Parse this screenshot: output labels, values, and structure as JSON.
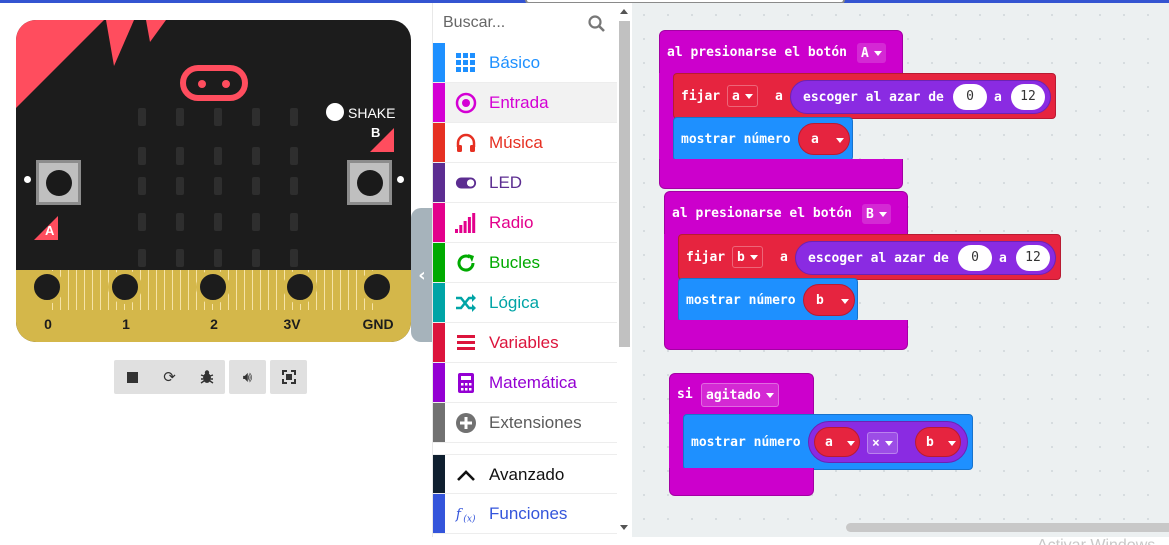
{
  "simulator": {
    "shake_label": "SHAKE",
    "button_a_label": "A",
    "button_b_label": "B",
    "pins": [
      "0",
      "1",
      "2",
      "3V",
      "GND"
    ],
    "controls": [
      "stop",
      "restart",
      "debug",
      "mute",
      "fullscreen"
    ]
  },
  "toolbox": {
    "search_placeholder": "Buscar...",
    "categories": [
      {
        "label": "Básico",
        "color": "#1E90FF",
        "icon": "grid-icon"
      },
      {
        "label": "Entrada",
        "color": "#D400D4",
        "icon": "target-icon"
      },
      {
        "label": "Música",
        "color": "#E63022",
        "icon": "headphones-icon"
      },
      {
        "label": "LED",
        "color": "#5C2D91",
        "icon": "toggle-icon"
      },
      {
        "label": "Radio",
        "color": "#E3008C",
        "icon": "signal-bars-icon"
      },
      {
        "label": "Bucles",
        "color": "#00AA00",
        "icon": "refresh-icon"
      },
      {
        "label": "Lógica",
        "color": "#00A4A6",
        "icon": "shuffle-icon"
      },
      {
        "label": "Variables",
        "color": "#DC143C",
        "icon": "list-icon"
      },
      {
        "label": "Matemática",
        "color": "#9400D3",
        "icon": "calculator-icon"
      },
      {
        "label": "Extensiones",
        "color": "#717171",
        "icon": "plus-circle-icon"
      },
      {
        "label": "Avanzado",
        "color": "#0F1F2F",
        "icon": "chevron-up-icon"
      },
      {
        "label": "Funciones",
        "color": "#3455DB",
        "icon": "function-icon"
      }
    ]
  },
  "workspace": {
    "button_a_event": {
      "label": "al presionarse el botón",
      "button": "A",
      "set_label": "fijar",
      "variable": "a",
      "to_label": "a",
      "random_label": "escoger al azar de",
      "min": "0",
      "and_label": "a",
      "max": "12",
      "show_label": "mostrar número",
      "show_var": "a"
    },
    "button_b_event": {
      "label": "al presionarse el botón",
      "button": "B",
      "set_label": "fijar",
      "variable": "b",
      "to_label": "a",
      "random_label": "escoger al azar de",
      "min": "0",
      "and_label": "a",
      "max": "12",
      "show_label": "mostrar número",
      "show_var": "b"
    },
    "shake_event": {
      "if_label": "si",
      "gesture": "agitado",
      "show_label": "mostrar número",
      "left": "a",
      "operator": "×",
      "right": "b"
    }
  },
  "colors": {
    "event": "#CC00CC",
    "variables": "#E6243F",
    "basic": "#1E90FF",
    "math": "#8A2BE2",
    "accent": "#3454D1"
  },
  "watermark": "Activar Windows"
}
